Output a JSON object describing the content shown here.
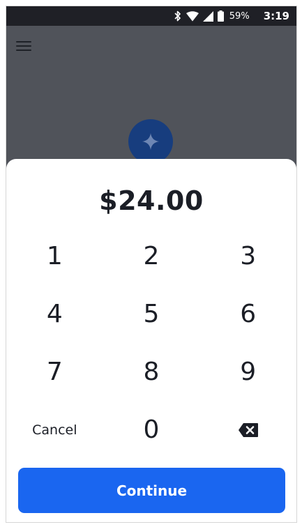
{
  "status_bar": {
    "icons": [
      "bluetooth-icon",
      "wifi-icon",
      "cellular-signal-icon",
      "battery-icon"
    ],
    "battery_percent": "59%",
    "time": "3:19"
  },
  "header": {
    "menu_icon": "hamburger-menu-icon",
    "badge_icon": "sparkle-icon"
  },
  "payment_sheet": {
    "amount": "$24.00",
    "keypad": [
      [
        "1",
        "2",
        "3"
      ],
      [
        "4",
        "5",
        "6"
      ],
      [
        "7",
        "8",
        "9"
      ]
    ],
    "cancel_label": "Cancel",
    "zero_label": "0",
    "backspace_icon": "backspace-icon",
    "continue_label": "Continue"
  },
  "colors": {
    "primary": "#1a66f0",
    "status_bar": "#1f2026",
    "backdrop": "#50535a",
    "badge": "#173d7e",
    "text": "#1b1e26"
  }
}
